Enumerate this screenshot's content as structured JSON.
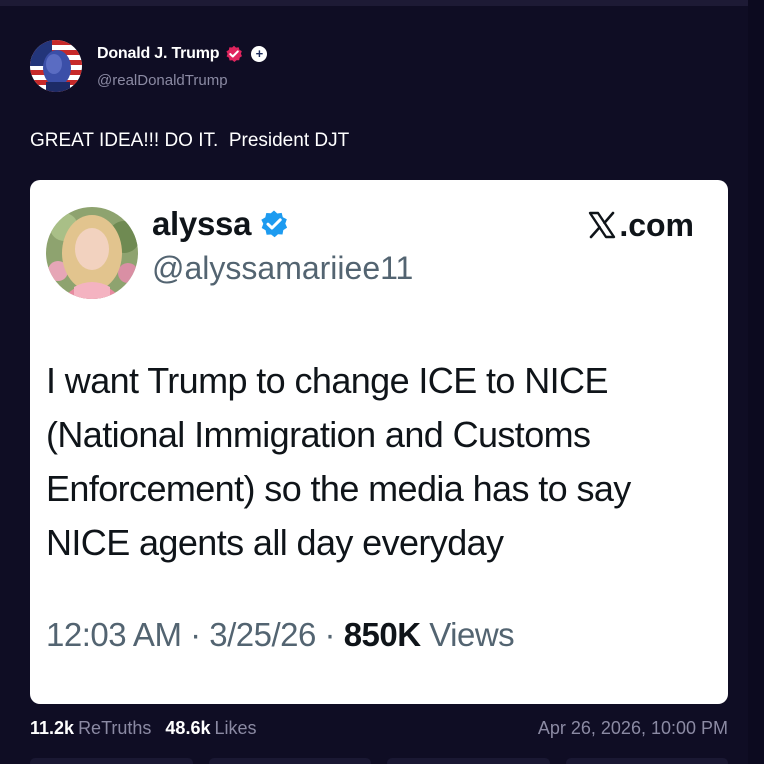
{
  "post": {
    "author": {
      "name": "Donald J. Trump",
      "handle": "@realDonaldTrump",
      "verified_icon": "verified-badge-icon",
      "plus_icon": "plus-badge-icon"
    },
    "text": "GREAT IDEA!!! DO IT.  President DJT",
    "stats": {
      "retruths_count": "11.2k",
      "retruths_label": "ReTruths",
      "likes_count": "48.6k",
      "likes_label": "Likes"
    },
    "timestamp": "Apr 26, 2026, 10:00 PM"
  },
  "quote": {
    "name": "alyssa",
    "handle": "@alyssamariiee11",
    "brand": ".com",
    "text": "I want Trump to change ICE to NICE (National Immigration and Customs Enforcement) so the media has to say NICE agents all day everyday",
    "time": "12:03 AM · 3/25/26 · ",
    "views_count": "850K",
    "views_label": " Views"
  },
  "colors": {
    "background": "#0f0d24",
    "card": "#ffffff",
    "muted_text": "#8b8aa3",
    "verified_red": "#e0245e",
    "verified_blue": "#1d9bf0"
  }
}
